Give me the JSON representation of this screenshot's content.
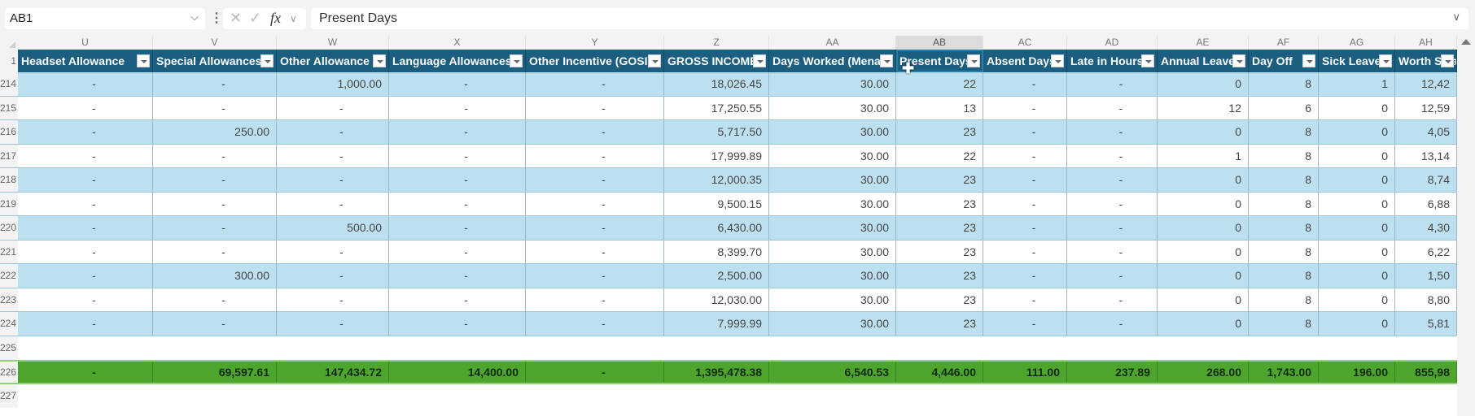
{
  "formula_bar": {
    "name_box": "AB1",
    "formula": "Present Days",
    "cancel_icon": "close-icon",
    "confirm_icon": "check-icon",
    "function_label": "fx"
  },
  "columns": [
    {
      "letter": "U",
      "header": "Headset Allowance"
    },
    {
      "letter": "V",
      "header": "Special Allowances"
    },
    {
      "letter": "W",
      "header": "Other Allowance"
    },
    {
      "letter": "X",
      "header": "Language Allowances"
    },
    {
      "letter": "Y",
      "header": "Other Incentive (GOSI)"
    },
    {
      "letter": "Z",
      "header": "GROSS INCOME"
    },
    {
      "letter": "AA",
      "header": "Days Worked (Mena)"
    },
    {
      "letter": "AB",
      "header": "Present Days"
    },
    {
      "letter": "AC",
      "header": "Absent Days"
    },
    {
      "letter": "AD",
      "header": "Late in Hours"
    },
    {
      "letter": "AE",
      "header": "Annual Leave"
    },
    {
      "letter": "AF",
      "header": "Day Off"
    },
    {
      "letter": "AG",
      "header": "Sick Leave"
    },
    {
      "letter": "AH",
      "header": "Worth Salary"
    }
  ],
  "header_row_number": "1",
  "selected_column": "AB",
  "rows": [
    {
      "num": "214",
      "cells": [
        "-",
        "-",
        "1,000.00",
        "-",
        "-",
        "18,026.45",
        "30.00",
        "22",
        "-",
        "-",
        "0",
        "8",
        "1",
        "12,42"
      ]
    },
    {
      "num": "215",
      "cells": [
        "-",
        "-",
        "-",
        "-",
        "-",
        "17,250.55",
        "30.00",
        "13",
        "-",
        "-",
        "12",
        "6",
        "0",
        "12,59"
      ]
    },
    {
      "num": "216",
      "cells": [
        "-",
        "250.00",
        "-",
        "-",
        "-",
        "5,717.50",
        "30.00",
        "23",
        "-",
        "-",
        "0",
        "8",
        "0",
        "4,05"
      ]
    },
    {
      "num": "217",
      "cells": [
        "-",
        "-",
        "-",
        "-",
        "-",
        "17,999.89",
        "30.00",
        "22",
        "-",
        "-",
        "1",
        "8",
        "0",
        "13,14"
      ]
    },
    {
      "num": "218",
      "cells": [
        "-",
        "-",
        "-",
        "-",
        "-",
        "12,000.35",
        "30.00",
        "23",
        "-",
        "-",
        "0",
        "8",
        "0",
        "8,74"
      ]
    },
    {
      "num": "219",
      "cells": [
        "-",
        "-",
        "-",
        "-",
        "-",
        "9,500.15",
        "30.00",
        "23",
        "-",
        "-",
        "0",
        "8",
        "0",
        "6,88"
      ]
    },
    {
      "num": "220",
      "cells": [
        "-",
        "-",
        "500.00",
        "-",
        "-",
        "6,430.00",
        "30.00",
        "23",
        "-",
        "-",
        "0",
        "8",
        "0",
        "4,30"
      ]
    },
    {
      "num": "221",
      "cells": [
        "-",
        "-",
        "-",
        "-",
        "-",
        "8,399.70",
        "30.00",
        "23",
        "-",
        "-",
        "0",
        "8",
        "0",
        "6,22"
      ]
    },
    {
      "num": "222",
      "cells": [
        "-",
        "300.00",
        "-",
        "-",
        "-",
        "2,500.00",
        "30.00",
        "23",
        "-",
        "-",
        "0",
        "8",
        "0",
        "1,50"
      ]
    },
    {
      "num": "223",
      "cells": [
        "-",
        "-",
        "-",
        "-",
        "-",
        "12,030.00",
        "30.00",
        "23",
        "-",
        "-",
        "0",
        "8",
        "0",
        "8,80"
      ]
    },
    {
      "num": "224",
      "cells": [
        "-",
        "-",
        "-",
        "-",
        "-",
        "7,999.99",
        "30.00",
        "23",
        "-",
        "-",
        "0",
        "8",
        "0",
        "5,81"
      ]
    }
  ],
  "empty_row_1": "225",
  "totals": {
    "num": "226",
    "cells": [
      "-",
      "69,597.61",
      "147,434.72",
      "14,400.00",
      "-",
      "1,395,478.38",
      "6,540.53",
      "4,446.00",
      "111.00",
      "237.89",
      "268.00",
      "1,743.00",
      "196.00",
      "855,98"
    ]
  },
  "empty_row_2": "227",
  "colors": {
    "header_bg": "#1b5e7f",
    "band_bg": "#bde0f0",
    "total_bg": "#4ea52e"
  }
}
